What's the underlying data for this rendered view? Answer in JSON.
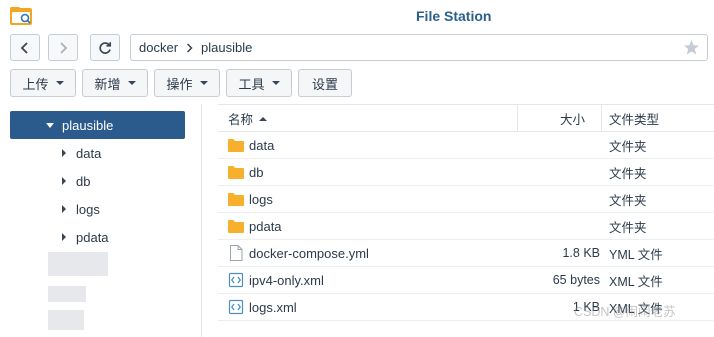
{
  "window": {
    "title": "File Station",
    "app_icon": "file-station-folder-icon"
  },
  "navigation": {
    "back_icon": "chevron-left-icon",
    "forward_icon": "chevron-right-icon",
    "refresh_icon": "refresh-icon",
    "path": [
      "docker",
      "plausible"
    ],
    "favorite_icon": "star-icon"
  },
  "toolbar": {
    "upload_label": "上传",
    "create_label": "新增",
    "action_label": "操作",
    "tools_label": "工具",
    "settings_label": "设置"
  },
  "sidebar": {
    "root": "plausible",
    "items": [
      {
        "label": "data"
      },
      {
        "label": "db"
      },
      {
        "label": "logs"
      },
      {
        "label": "pdata"
      }
    ]
  },
  "filelist": {
    "columns": {
      "name": "名称",
      "size": "大小",
      "type": "文件类型"
    },
    "rows": [
      {
        "name": "data",
        "size": "",
        "type": "文件夹",
        "icon": "folder-icon"
      },
      {
        "name": "db",
        "size": "",
        "type": "文件夹",
        "icon": "folder-icon"
      },
      {
        "name": "logs",
        "size": "",
        "type": "文件夹",
        "icon": "folder-icon"
      },
      {
        "name": "pdata",
        "size": "",
        "type": "文件夹",
        "icon": "folder-icon"
      },
      {
        "name": "docker-compose.yml",
        "size": "1.8 KB",
        "type": "YML 文件",
        "icon": "file-icon"
      },
      {
        "name": "ipv4-only.xml",
        "size": "65 bytes",
        "type": "XML 文件",
        "icon": "xml-file-icon"
      },
      {
        "name": "logs.xml",
        "size": "1 KB",
        "type": "XML 文件",
        "icon": "xml-file-icon"
      }
    ]
  },
  "watermark": "CSDN @闹闹老苏",
  "colors": {
    "selected": "#2a5b8c",
    "title": "#2c5f8a",
    "folder": "#f6b02b"
  }
}
